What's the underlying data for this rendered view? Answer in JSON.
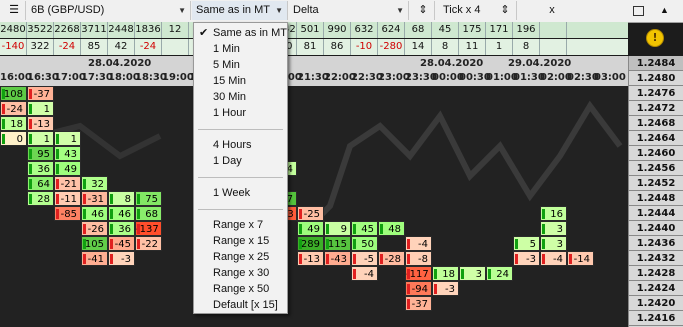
{
  "toolbar": {
    "instrument": "6B (GBP/USD)",
    "timeframe": "Same as in MT",
    "mode": "Delta",
    "tick": "Tick x 4",
    "close": "x"
  },
  "summary": {
    "top": [
      "2480",
      "3522",
      "2268",
      "3711",
      "2448",
      "1836",
      "12",
      "",
      "",
      "1145",
      "1442",
      "501",
      "990",
      "632",
      "624",
      "68",
      "45",
      "175",
      "171",
      "196",
      ""
    ],
    "bottom": [
      "-140",
      "322",
      "-24",
      "85",
      "42",
      "-24",
      "",
      "",
      "",
      "45",
      "300",
      "81",
      "86",
      "-10",
      "-280",
      "14",
      "8",
      "11",
      "1",
      "8",
      ""
    ]
  },
  "header": {
    "dates": [
      "28.04.2020",
      "28.04.2020",
      "29.04.2020"
    ],
    "times": [
      "16:00",
      "16:30",
      "17:00",
      "17:30",
      "18:00",
      "18:30",
      "19:00",
      "19:30",
      "20:00",
      "20:30",
      "21:00",
      "21:30",
      "22:00",
      "22:30",
      "23:00",
      "23:30",
      "00:00",
      "00:30",
      "01:00",
      "01:30",
      "02:00",
      "02:30",
      "03:00"
    ]
  },
  "prices": [
    "1.2484",
    "1.2480",
    "1.2476",
    "1.2472",
    "1.2468",
    "1.2464",
    "1.2460",
    "1.2456",
    "1.2452",
    "1.2448",
    "1.2444",
    "1.2440",
    "1.2436",
    "1.2432",
    "1.2428",
    "1.2424",
    "1.2420",
    "1.2416"
  ],
  "menu": {
    "items": [
      "Same as in MT",
      "1 Min",
      "5 Min",
      "15 Min",
      "30 Min",
      "1 Hour",
      "4 Hours",
      "1 Day",
      "1 Week",
      "Range x 7",
      "Range x 15",
      "Range x 25",
      "Range x 30",
      "Range x 50",
      "Default [x 15]"
    ],
    "selected": "Same as in MT"
  },
  "cells": [
    {
      "v": "108",
      "col": 0,
      "row": 0
    },
    {
      "v": "-37",
      "col": 1,
      "row": 0
    },
    {
      "v": "-24",
      "col": 0,
      "row": 1
    },
    {
      "v": "1",
      "col": 1,
      "row": 1
    },
    {
      "v": "18",
      "col": 0,
      "row": 2
    },
    {
      "v": "-13",
      "col": 1,
      "row": 2
    },
    {
      "v": "0",
      "col": 0,
      "row": 3
    },
    {
      "v": "1",
      "col": 1,
      "row": 3
    },
    {
      "v": "1",
      "col": 2,
      "row": 3
    },
    {
      "v": "95",
      "col": 1,
      "row": 4
    },
    {
      "v": "43",
      "col": 2,
      "row": 4
    },
    {
      "v": "36",
      "col": 1,
      "row": 5
    },
    {
      "v": "49",
      "col": 2,
      "row": 5
    },
    {
      "v": "64",
      "col": 1,
      "row": 6
    },
    {
      "v": "-21",
      "col": 2,
      "row": 6
    },
    {
      "v": "32",
      "col": 3,
      "row": 6
    },
    {
      "v": "28",
      "col": 1,
      "row": 7
    },
    {
      "v": "-11",
      "col": 2,
      "row": 7
    },
    {
      "v": "-31",
      "col": 3,
      "row": 7
    },
    {
      "v": "8",
      "col": 4,
      "row": 7
    },
    {
      "v": "75",
      "col": 5,
      "row": 7
    },
    {
      "v": "-85",
      "col": 2,
      "row": 8
    },
    {
      "v": "46",
      "col": 3,
      "row": 8
    },
    {
      "v": "46",
      "col": 4,
      "row": 8
    },
    {
      "v": "68",
      "col": 5,
      "row": 8
    },
    {
      "v": "-26",
      "col": 3,
      "row": 9
    },
    {
      "v": "36",
      "col": 4,
      "row": 9
    },
    {
      "v": "-137",
      "col": 5,
      "row": 9
    },
    {
      "v": "105",
      "col": 3,
      "row": 10
    },
    {
      "v": "-45",
      "col": 4,
      "row": 10
    },
    {
      "v": "-22",
      "col": 5,
      "row": 10
    },
    {
      "v": "-41",
      "col": 3,
      "row": 11
    },
    {
      "v": "-3",
      "col": 4,
      "row": 11
    },
    {
      "v": "14",
      "col": 10,
      "row": 5
    },
    {
      "v": "0",
      "col": 9,
      "row": 7
    },
    {
      "v": "117",
      "col": 10,
      "row": 7
    },
    {
      "v": "-123",
      "col": 10,
      "row": 8
    },
    {
      "v": "-25",
      "col": 11,
      "row": 8
    },
    {
      "v": "49",
      "col": 11,
      "row": 9
    },
    {
      "v": "9",
      "col": 12,
      "row": 9
    },
    {
      "v": "45",
      "col": 13,
      "row": 9
    },
    {
      "v": "48",
      "col": 14,
      "row": 9
    },
    {
      "v": "289",
      "col": 11,
      "row": 10
    },
    {
      "v": "115",
      "col": 12,
      "row": 10
    },
    {
      "v": "50",
      "col": 13,
      "row": 10
    },
    {
      "v": "-4",
      "col": 15,
      "row": 10
    },
    {
      "v": "-13",
      "col": 11,
      "row": 11
    },
    {
      "v": "-43",
      "col": 12,
      "row": 11
    },
    {
      "v": "-5",
      "col": 13,
      "row": 11
    },
    {
      "v": "-28",
      "col": 14,
      "row": 11
    },
    {
      "v": "-8",
      "col": 15,
      "row": 11
    },
    {
      "v": "-4",
      "col": 13,
      "row": 12
    },
    {
      "v": "-117",
      "col": 15,
      "row": 12
    },
    {
      "v": "18",
      "col": 16,
      "row": 12
    },
    {
      "v": "3",
      "col": 17,
      "row": 12
    },
    {
      "v": "24",
      "col": 18,
      "row": 12
    },
    {
      "v": "-94",
      "col": 15,
      "row": 13
    },
    {
      "v": "-3",
      "col": 16,
      "row": 13
    },
    {
      "v": "-37",
      "col": 15,
      "row": 14
    },
    {
      "v": "16",
      "col": 20,
      "row": 8
    },
    {
      "v": "3",
      "col": 20,
      "row": 9
    },
    {
      "v": "5",
      "col": 19,
      "row": 10
    },
    {
      "v": "3",
      "col": 20,
      "row": 10
    },
    {
      "v": "-3",
      "col": 19,
      "row": 11
    },
    {
      "v": "-4",
      "col": 20,
      "row": 11
    },
    {
      "v": "-14",
      "col": 21,
      "row": 11
    }
  ]
}
